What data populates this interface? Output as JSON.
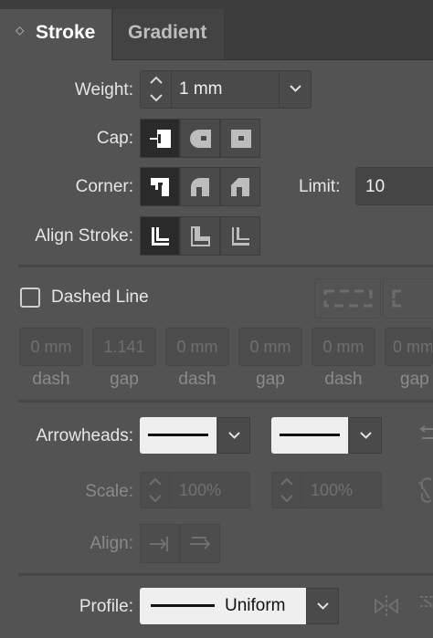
{
  "tabs": [
    {
      "label": "Stroke",
      "active": true
    },
    {
      "label": "Gradient",
      "active": false
    }
  ],
  "weight": {
    "label": "Weight:",
    "value": "1 mm"
  },
  "cap": {
    "label": "Cap:"
  },
  "corner": {
    "label": "Corner:",
    "limit_label": "Limit:",
    "limit_value": "10"
  },
  "align_stroke": {
    "label": "Align Stroke:"
  },
  "dashed": {
    "label": "Dashed Line",
    "checked": false,
    "fields": [
      {
        "value": "0 mm",
        "label": "dash"
      },
      {
        "value": "1.141",
        "label": "gap"
      },
      {
        "value": "0 mm",
        "label": "dash"
      },
      {
        "value": "0 mm",
        "label": "gap"
      },
      {
        "value": "0 mm",
        "label": "dash"
      },
      {
        "value": "0 mm",
        "label": "gap"
      }
    ]
  },
  "arrowheads": {
    "label": "Arrowheads:"
  },
  "scale": {
    "label": "Scale:",
    "start": "100%",
    "end": "100%"
  },
  "align_arrows": {
    "label": "Align:"
  },
  "profile": {
    "label": "Profile:",
    "value": "Uniform"
  },
  "colors": {
    "panel": "#535353",
    "tab_active": "#535353",
    "tab_bar": "#3a3a3a"
  }
}
